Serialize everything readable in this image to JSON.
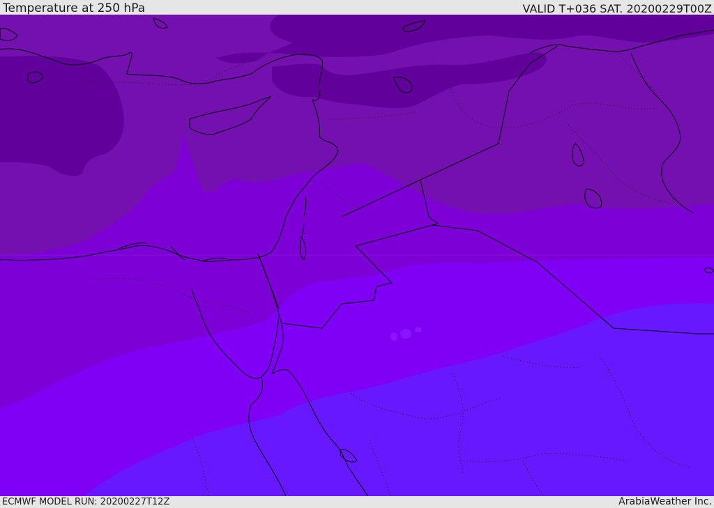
{
  "header": {
    "title": "Temperature at 250 hPa",
    "valid": "VALID T+036 SAT. 20200229T00Z"
  },
  "footer": {
    "model_run": "ECMWF MODEL RUN: 20200227T12Z",
    "credit": "ArabiaWeather Inc."
  },
  "colors": {
    "band_coldest": "#61009a",
    "band_cold": "#7510b0",
    "band_mid": "#7d00d6",
    "band_warm": "#8000f5",
    "band_warmest": "#6818ff",
    "coastline": "#000000",
    "background": "#e6e6e6"
  }
}
